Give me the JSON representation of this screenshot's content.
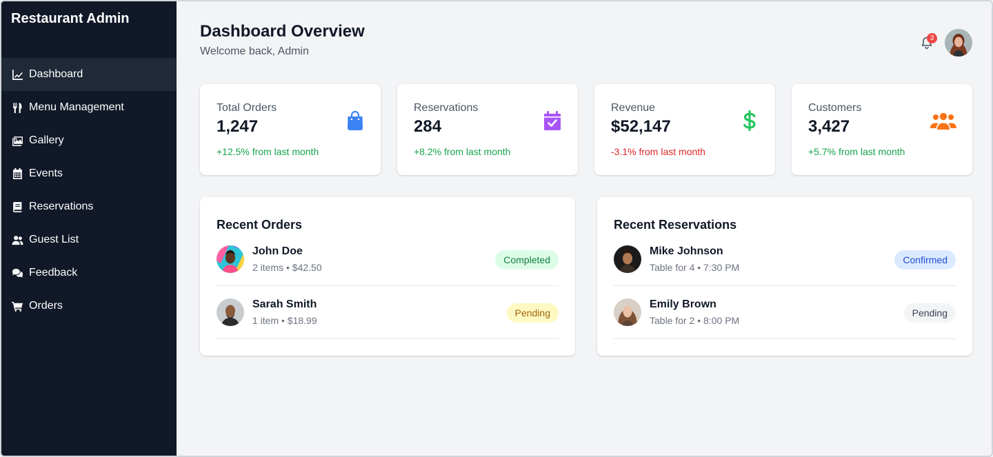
{
  "sidebar": {
    "brand": "Restaurant Admin",
    "items": [
      {
        "label": "Dashboard",
        "icon": "chart-line-icon",
        "active": true
      },
      {
        "label": "Menu Management",
        "icon": "utensils-icon"
      },
      {
        "label": "Gallery",
        "icon": "images-icon"
      },
      {
        "label": "Events",
        "icon": "calendar-icon"
      },
      {
        "label": "Reservations",
        "icon": "book-icon"
      },
      {
        "label": "Guest List",
        "icon": "users-icon"
      },
      {
        "label": "Feedback",
        "icon": "comments-icon"
      },
      {
        "label": "Orders",
        "icon": "cart-icon"
      }
    ]
  },
  "header": {
    "title": "Dashboard Overview",
    "subtitle": "Welcome back, Admin",
    "notification_count": "3"
  },
  "stats": [
    {
      "label": "Total Orders",
      "value": "1,247",
      "change": "+12.5% from last month",
      "change_color": "#16a34a",
      "icon": "shopping-bag-icon",
      "icon_color": "#3b82f6"
    },
    {
      "label": "Reservations",
      "value": "284",
      "change": "+8.2% from last month",
      "change_color": "#16a34a",
      "icon": "calendar-check-icon",
      "icon_color": "#a855f7"
    },
    {
      "label": "Revenue",
      "value": "$52,147",
      "change": "-3.1% from last month",
      "change_color": "#dc2626",
      "icon": "dollar-icon",
      "icon_color": "#22c55e"
    },
    {
      "label": "Customers",
      "value": "3,427",
      "change": "+5.7% from last month",
      "change_color": "#16a34a",
      "icon": "users-icon",
      "icon_color": "#f97316"
    }
  ],
  "recent_orders": {
    "title": "Recent Orders",
    "rows": [
      {
        "name": "John Doe",
        "meta": "2 items • $42.50",
        "status": "Completed",
        "status_style": "green"
      },
      {
        "name": "Sarah Smith",
        "meta": "1 item • $18.99",
        "status": "Pending",
        "status_style": "yellow"
      }
    ]
  },
  "recent_reservations": {
    "title": "Recent Reservations",
    "rows": [
      {
        "name": "Mike Johnson",
        "meta": "Table for 4 • 7:30 PM",
        "status": "Confirmed",
        "status_style": "blue"
      },
      {
        "name": "Emily Brown",
        "meta": "Table for 2 • 8:00 PM",
        "status": "Pending",
        "status_style": "gray"
      }
    ]
  }
}
